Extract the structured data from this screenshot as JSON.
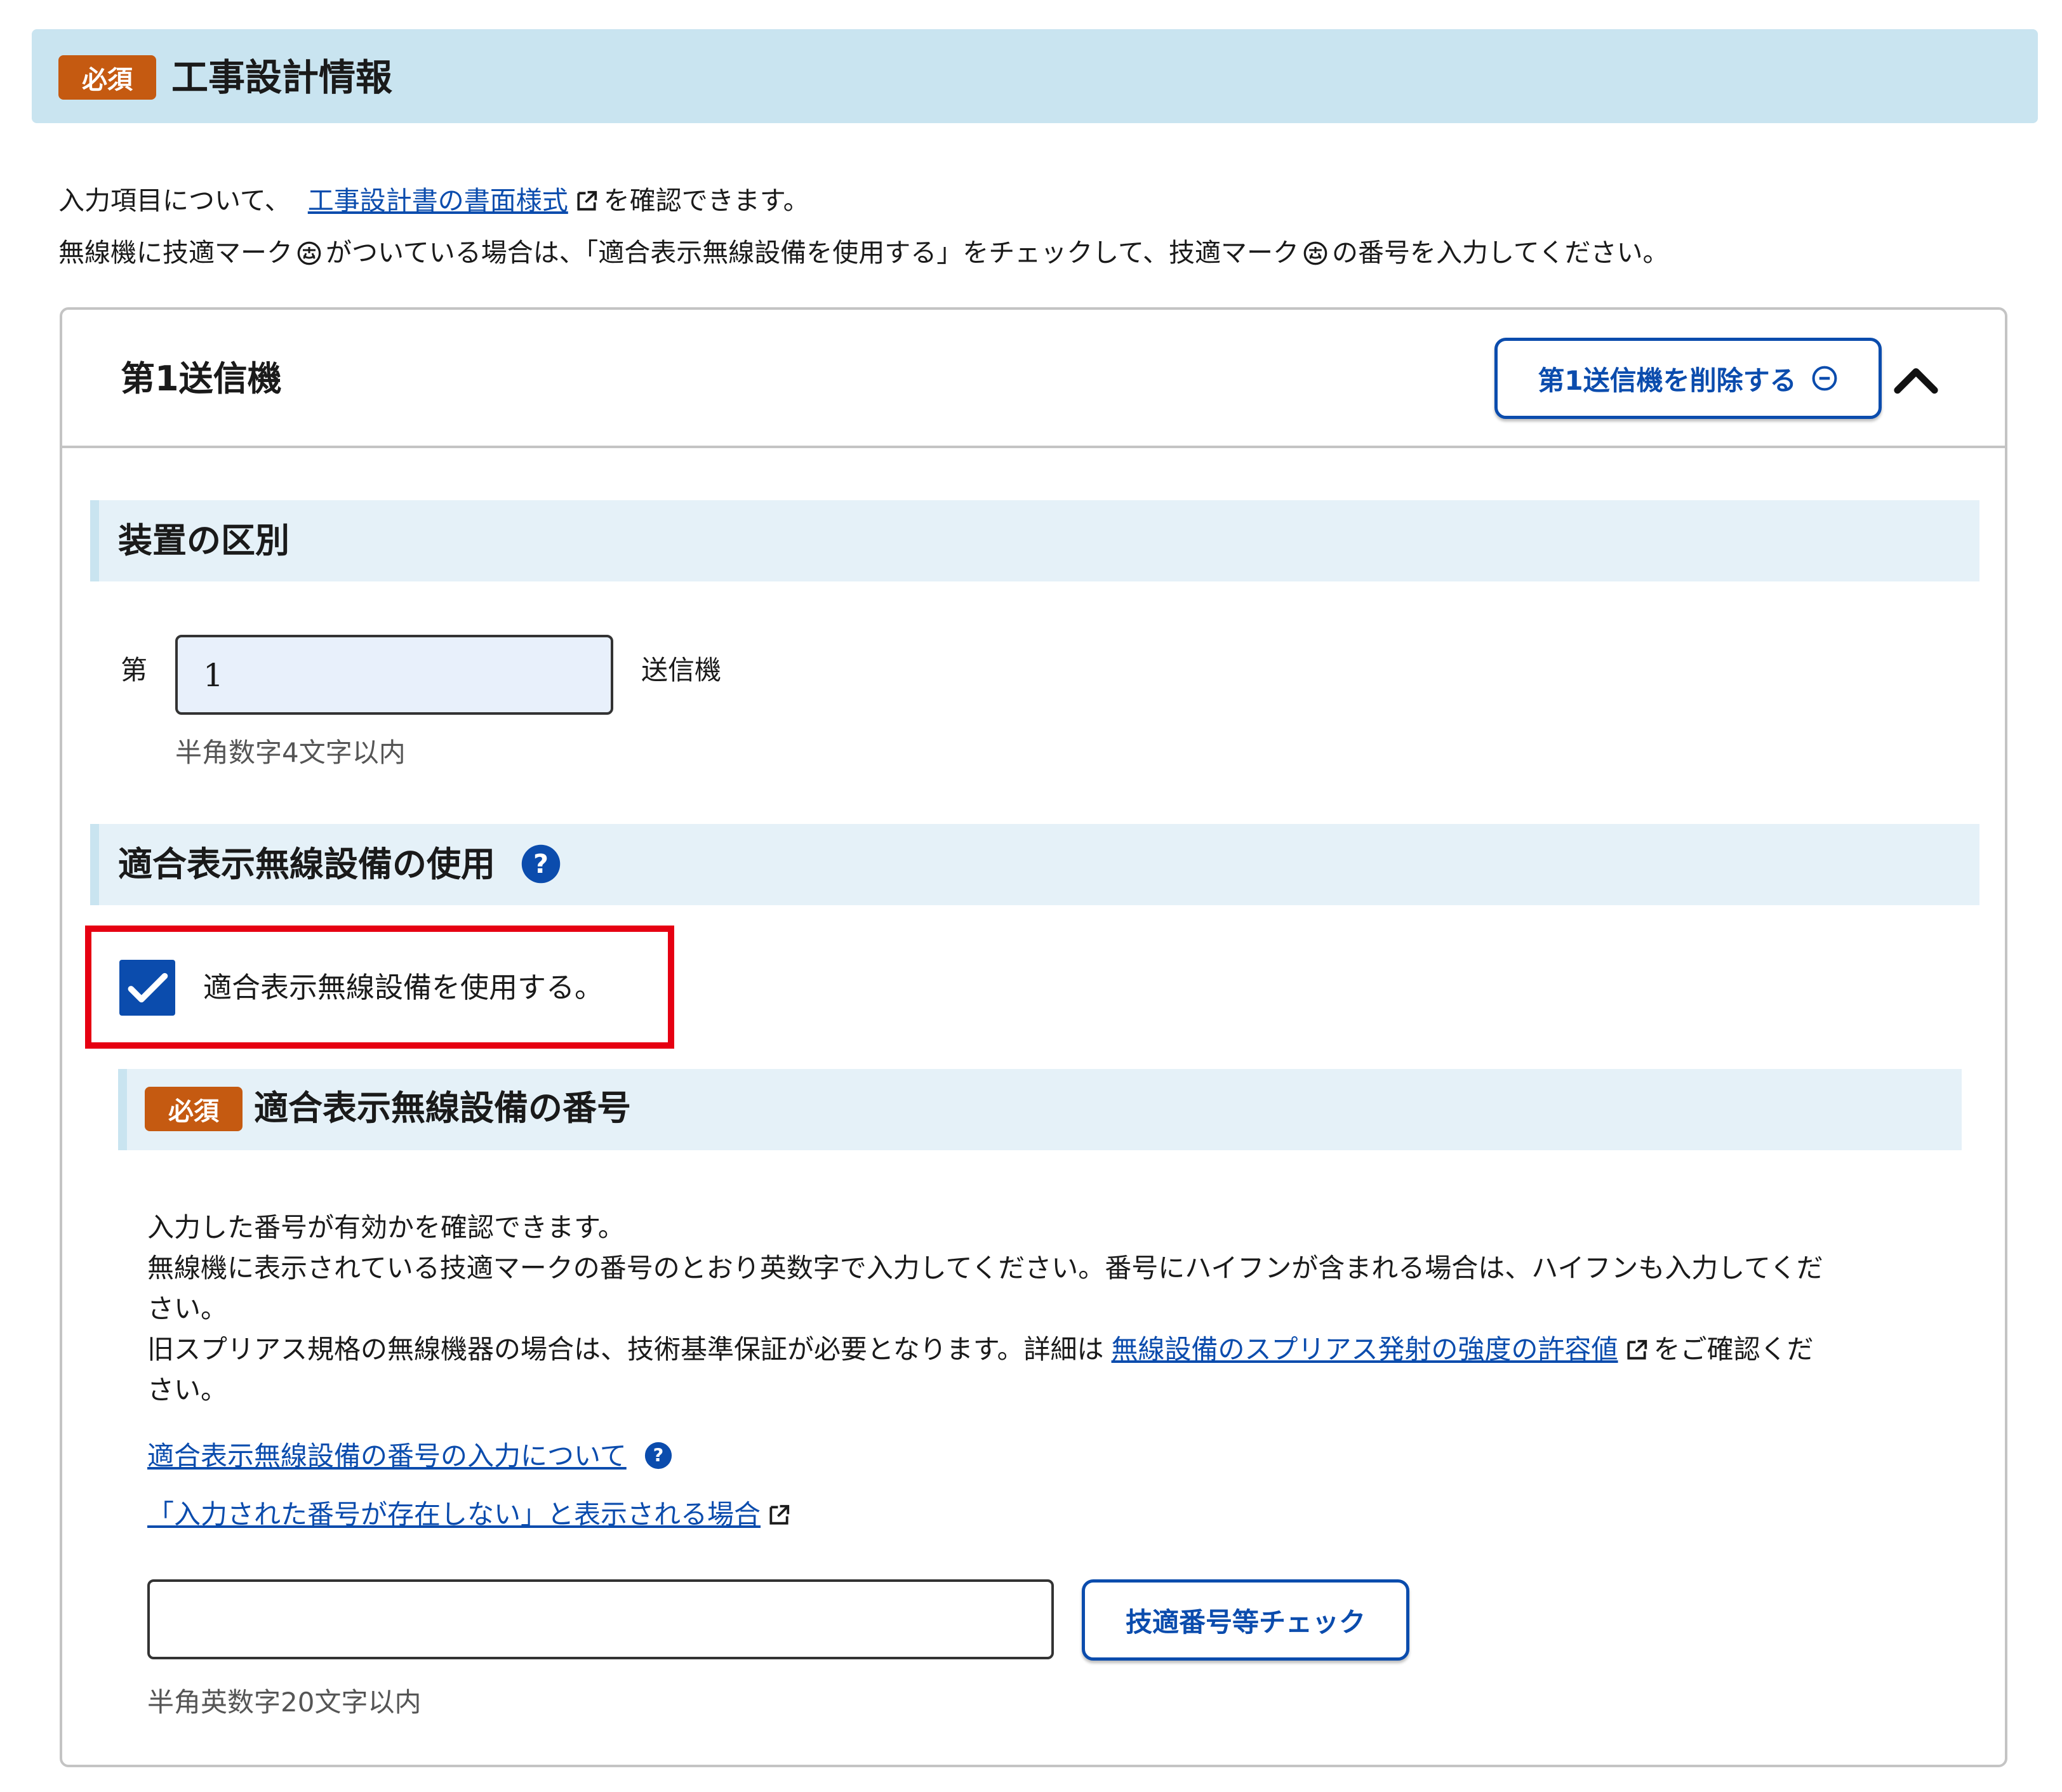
{
  "header": {
    "badge": "必須",
    "title": "工事設計情報"
  },
  "intro": {
    "line1_prefix": "入力項目について、",
    "line1_link": "工事設計書の書面様式",
    "line1_suffix": "を確認できます。",
    "line2_part1": "無線機に技適マーク",
    "line2_part2": "がついている場合は、「適合表示無線設備を使用する」をチェックして、技適マーク",
    "line2_part3": "の番号を入力してください。"
  },
  "transmitter": {
    "title": "第1送信機",
    "delete_button": "第1送信機を削除する",
    "device_section": {
      "heading": "装置の区別",
      "prefix": "第",
      "value": "1",
      "suffix": "送信機",
      "hint": "半角数字4文字以内"
    },
    "compliance_section": {
      "heading": "適合表示無線設備の使用",
      "checkbox_label": "適合表示無線設備を使用する。",
      "checked": true
    },
    "number_section": {
      "badge": "必須",
      "heading": "適合表示無線設備の番号",
      "desc_line1": "入力した番号が有効かを確認できます。",
      "desc_line2": "無線機に表示されている技適マークの番号のとおり英数字で入力してください。番号にハイフンが含まれる場合は、ハイフンも入力してくだ",
      "desc_line3": "さい。",
      "desc_line4_prefix": "旧スプリアス規格の無線機器の場合は、技術基準保証が必要となります。詳細は",
      "desc_line4_link": "無線設備のスプリアス発射の強度の許容値",
      "desc_line4_suffix": "をご確認くだ",
      "desc_line5": "さい。",
      "link_input_guide": "適合表示無線設備の番号の入力について",
      "link_not_exist": "「入力された番号が存在しない」と表示される場合",
      "input_value": "",
      "check_button": "技適番号等チェック",
      "hint": "半角英数字20文字以内"
    }
  },
  "colors": {
    "banner": "#c9e4f0",
    "badge": "#c55a11",
    "primary": "#0b4cad",
    "highlight": "#e60012",
    "section_bg": "#e5f1f8"
  }
}
